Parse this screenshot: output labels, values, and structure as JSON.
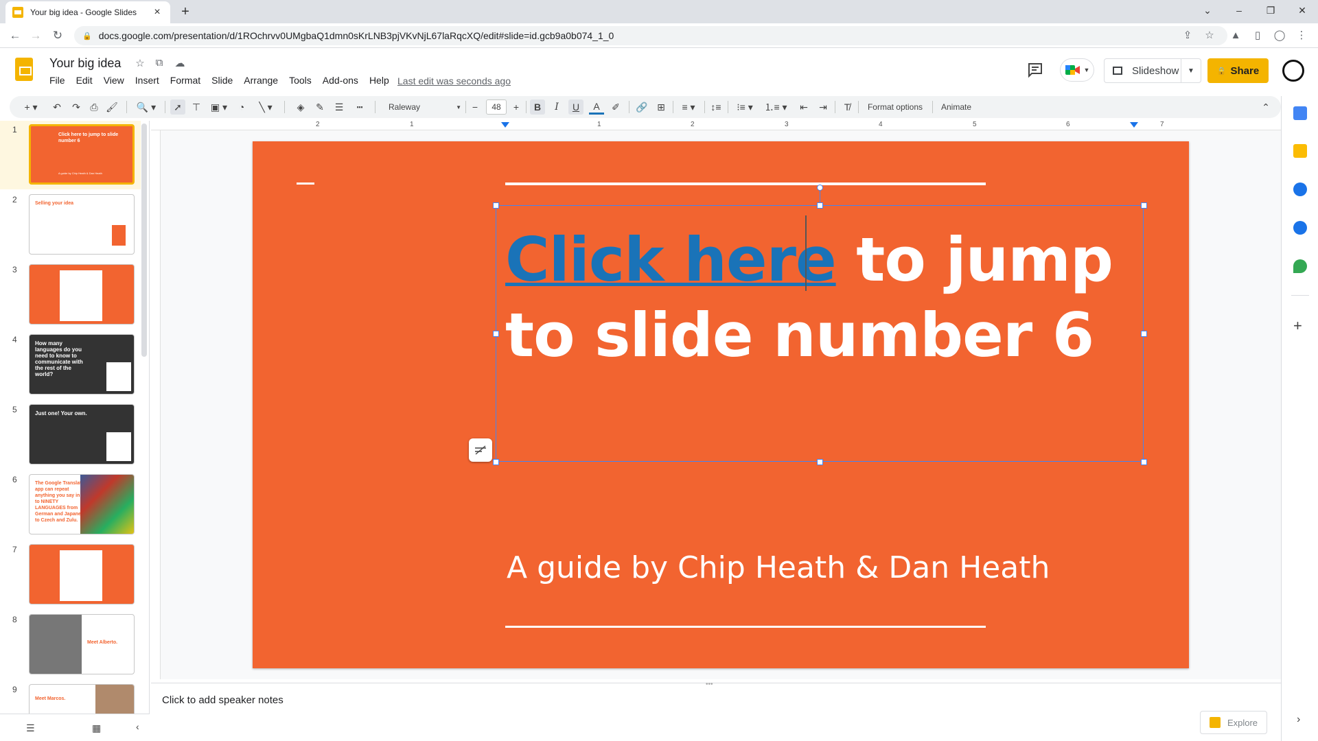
{
  "browser": {
    "tab_title": "Your big idea - Google Slides",
    "url": "docs.google.com/presentation/d/1ROchrvv0UMgbaQ1dmn0sKrLNB3pjVKvNjL67laRqcXQ/edit#slide=id.gcb9a0b074_1_0"
  },
  "app": {
    "doc_title": "Your big idea",
    "last_edit": "Last edit was seconds ago",
    "menu": [
      "File",
      "Edit",
      "View",
      "Insert",
      "Format",
      "Slide",
      "Arrange",
      "Tools",
      "Add-ons",
      "Help"
    ],
    "slideshow_label": "Slideshow",
    "share_label": "Share"
  },
  "toolbar": {
    "font": "Raleway",
    "font_size": "48",
    "format_options": "Format options",
    "animate": "Animate"
  },
  "ruler": {
    "labels": [
      "2",
      "1",
      "1",
      "2",
      "3",
      "4",
      "5",
      "6",
      "7"
    ]
  },
  "filmstrip": {
    "slides": [
      {
        "num": "1",
        "text": "Click here to jump to slide number 6",
        "sub": "A guide by Chip Heath & Dan Heath",
        "bg": "#f26430",
        "selected": true
      },
      {
        "num": "2",
        "text": "Selling your idea",
        "bg": "#ffffff",
        "selected": false
      },
      {
        "num": "3",
        "text": "",
        "bg": "#f26430",
        "selected": false
      },
      {
        "num": "4",
        "text": "How many languages do you need to know to communicate with the rest of the world?",
        "bg": "#333333",
        "selected": false
      },
      {
        "num": "5",
        "text": "Just one! Your own.",
        "bg": "#333333",
        "selected": false
      },
      {
        "num": "6",
        "text": "The Google Translate app can repeat anything you say in up to NINETY LANGUAGES from German and Japanese to Czech and Zulu.",
        "bg": "#ffffff",
        "selected": false
      },
      {
        "num": "7",
        "text": "",
        "bg": "#f26430",
        "selected": false
      },
      {
        "num": "8",
        "text": "Meet Alberto.",
        "bg": "#ffffff",
        "selected": false
      },
      {
        "num": "9",
        "text": "Meet Marcos.",
        "bg": "#ffffff",
        "selected": false
      }
    ]
  },
  "slide": {
    "title_link": "Click here",
    "title_rest_line1": " to jump",
    "title_line2": "to slide number 6",
    "subtitle": "A guide by Chip Heath & Dan Heath",
    "bg": "#f26430",
    "link_color": "#1a73b8"
  },
  "notes": {
    "placeholder": "Click to add speaker notes"
  },
  "explore_label": "Explore"
}
